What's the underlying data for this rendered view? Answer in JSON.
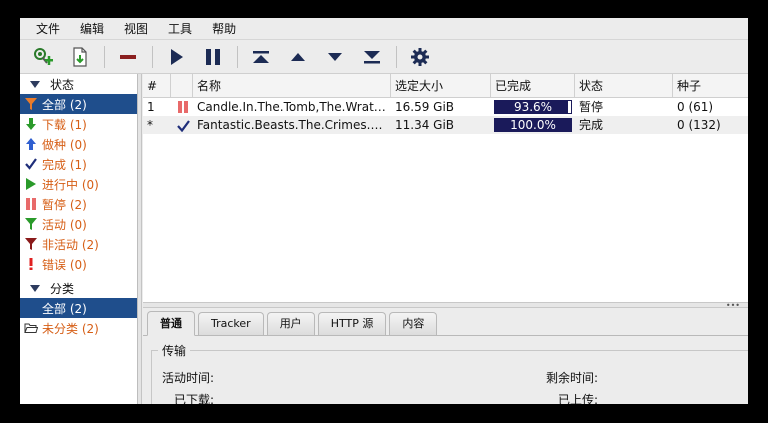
{
  "menu": [
    "文件",
    "编辑",
    "视图",
    "工具",
    "帮助"
  ],
  "toolbar": {
    "buttons": [
      "add-torrent-icon",
      "create-torrent-icon",
      "remove-icon",
      "resume-icon",
      "pause-icon",
      "queue-top-icon",
      "queue-up-icon",
      "queue-down-icon",
      "queue-bottom-icon",
      "preferences-icon"
    ]
  },
  "sidebar": {
    "status_header": "状态",
    "status_items": [
      {
        "label": "全部 (2)",
        "icon": "all-filter-icon",
        "color": "#e87b2b",
        "selected": true
      },
      {
        "label": "下载 (1)",
        "icon": "download-arrow-icon",
        "color": "#2a9a2a"
      },
      {
        "label": "做种 (0)",
        "icon": "upload-arrow-icon",
        "color": "#2f5fd0"
      },
      {
        "label": "完成 (1)",
        "icon": "check-icon",
        "color": "#1f2e7a"
      },
      {
        "label": "进行中 (0)",
        "icon": "play-icon",
        "color": "#2a9a2a"
      },
      {
        "label": "暂停 (2)",
        "icon": "pause-icon",
        "color": "#e86a6a"
      },
      {
        "label": "活动 (0)",
        "icon": "active-filter-icon",
        "color": "#2a9a2a"
      },
      {
        "label": "非活动 (2)",
        "icon": "inactive-filter-icon",
        "color": "#8a1a1a"
      },
      {
        "label": "错误 (0)",
        "icon": "error-icon",
        "color": "#e02020"
      }
    ],
    "category_header": "分类",
    "category_items": [
      {
        "label": "全部 (2)",
        "selected": true
      },
      {
        "label": "未分类 (2)",
        "icon": "folder-icon"
      }
    ]
  },
  "table": {
    "headers": [
      "#",
      "",
      "名称",
      "选定大小",
      "已完成",
      "状态",
      "种子"
    ],
    "rows": [
      {
        "num": "1",
        "state_icon": "paused-icon",
        "name": "Candle.In.The.Tomb,The.Wrath.Of...",
        "size": "16.59 GiB",
        "progress": 0.936,
        "progress_label": "93.6%",
        "status": "暂停",
        "seeds": "0 (61)"
      },
      {
        "num": "*",
        "state_icon": "completed-check-icon",
        "name": "Fantastic.Beasts.The.Crimes.Of.G...",
        "size": "11.34 GiB",
        "progress": 1.0,
        "progress_label": "100.0%",
        "status": "完成",
        "seeds": "0 (132)"
      }
    ]
  },
  "tabs": [
    "普通",
    "Tracker",
    "用户",
    "HTTP 源",
    "内容"
  ],
  "details": {
    "transfer_title": "传输",
    "active_time_label": "活动时间:",
    "remaining_label": "剩余时间:",
    "downloaded_label": "已下载:",
    "uploaded_label": "已上传:"
  },
  "colors": {
    "selection": "#1f4e8c",
    "progress": "#1a1a5a",
    "orange_text": "#d65e15"
  }
}
